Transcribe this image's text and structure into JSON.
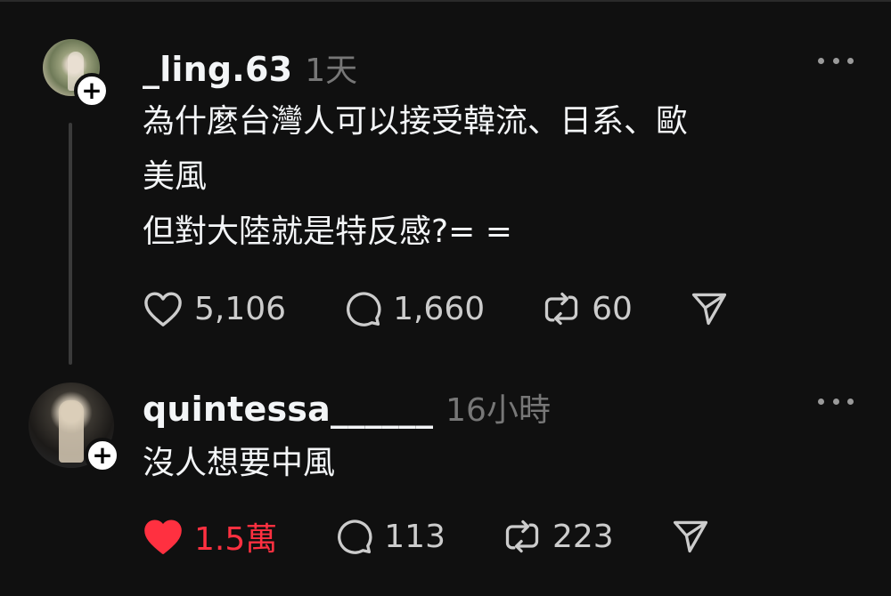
{
  "posts": [
    {
      "username": "_ling.63",
      "time": "1天",
      "text": "為什麼台灣人可以接受韓流、日系、歐\n美風\n但對大陸就是特反感?= =",
      "likes": "5,106",
      "replies": "1,660",
      "reposts": "60",
      "liked": false
    },
    {
      "username": "quintessa______",
      "time": "16小時",
      "text": "沒人想要中風",
      "likes": "1.5萬",
      "replies": "113",
      "reposts": "223",
      "liked": true
    }
  ],
  "icons": {
    "like": "heart-icon",
    "reply": "speech-bubble-icon",
    "repost": "repost-icon",
    "share": "send-icon",
    "follow": "plus-icon",
    "more": "more-dots-icon"
  },
  "colors": {
    "background": "#101010",
    "text": "#f3f5f7",
    "muted": "#777777",
    "liked": "#ff3040"
  }
}
